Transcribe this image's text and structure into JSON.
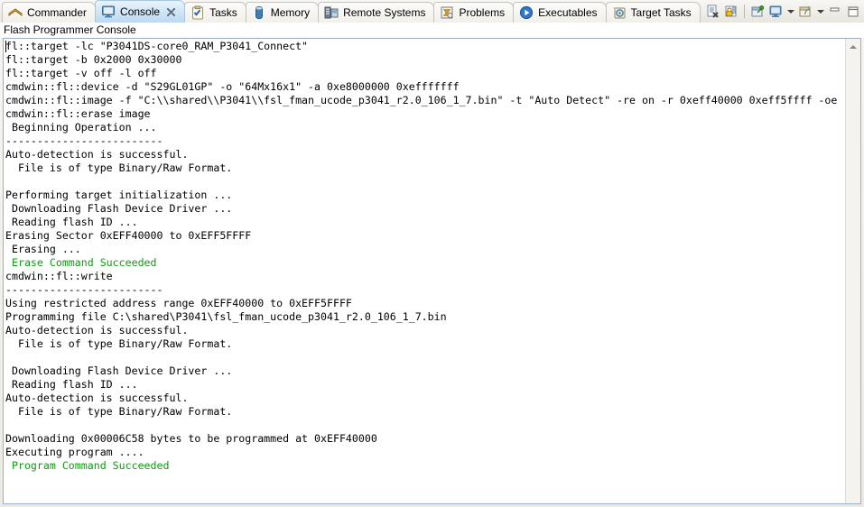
{
  "window": {
    "view_title": "Flash Programmer Console"
  },
  "tabs": [
    {
      "label": "Commander",
      "icon": "commander-icon",
      "active": false,
      "closable": false
    },
    {
      "label": "Console",
      "icon": "console-icon",
      "active": true,
      "closable": true
    },
    {
      "label": "Tasks",
      "icon": "tasks-icon",
      "active": false,
      "closable": false
    },
    {
      "label": "Memory",
      "icon": "memory-icon",
      "active": false,
      "closable": false
    },
    {
      "label": "Remote Systems",
      "icon": "remote-systems-icon",
      "active": false,
      "closable": false
    },
    {
      "label": "Problems",
      "icon": "problems-icon",
      "active": false,
      "closable": false
    },
    {
      "label": "Executables",
      "icon": "executables-icon",
      "active": false,
      "closable": false
    },
    {
      "label": "Target Tasks",
      "icon": "target-tasks-icon",
      "active": false,
      "closable": false
    }
  ],
  "toolbar": {
    "buttons": [
      {
        "name": "clear-console-icon",
        "title": "Clear Console"
      },
      {
        "name": "scroll-lock-icon",
        "title": "Scroll Lock"
      },
      {
        "name": "pin-console-icon",
        "title": "Pin Console"
      },
      {
        "name": "display-console-icon",
        "title": "Display Selected Console"
      },
      {
        "name": "open-console-icon",
        "title": "Open Console"
      },
      {
        "name": "minimize-icon",
        "title": "Minimize"
      },
      {
        "name": "maximize-icon",
        "title": "Maximize"
      }
    ]
  },
  "console": {
    "lines": [
      {
        "text": "fl::target -lc \"P3041DS-core0_RAM_P3041_Connect\"",
        "color": "black"
      },
      {
        "text": "fl::target -b 0x2000 0x30000",
        "color": "black"
      },
      {
        "text": "fl::target -v off -l off",
        "color": "black"
      },
      {
        "text": "cmdwin::fl::device -d \"S29GL01GP\" -o \"64Mx16x1\" -a 0xe8000000 0xefffffff",
        "color": "black"
      },
      {
        "text": "cmdwin::fl::image -f \"C:\\\\shared\\\\P3041\\\\fsl_fman_ucode_p3041_r2.0_106_1_7.bin\" -t \"Auto Detect\" -re on -r 0xeff40000 0xeff5ffff -oe",
        "color": "black"
      },
      {
        "text": "cmdwin::fl::erase image",
        "color": "black"
      },
      {
        "text": " Beginning Operation ...",
        "color": "black"
      },
      {
        "text": "-------------------------",
        "color": "black"
      },
      {
        "text": "Auto-detection is successful.",
        "color": "black"
      },
      {
        "text": "  File is of type Binary/Raw Format.",
        "color": "black"
      },
      {
        "text": "",
        "color": "black"
      },
      {
        "text": "Performing target initialization ...",
        "color": "black"
      },
      {
        "text": " Downloading Flash Device Driver ...",
        "color": "black"
      },
      {
        "text": " Reading flash ID ...",
        "color": "black"
      },
      {
        "text": "Erasing Sector 0xEFF40000 to 0xEFF5FFFF",
        "color": "black"
      },
      {
        "text": " Erasing ...",
        "color": "black"
      },
      {
        "text": " Erase Command Succeeded",
        "color": "green"
      },
      {
        "text": "cmdwin::fl::write",
        "color": "black"
      },
      {
        "text": "-------------------------",
        "color": "black"
      },
      {
        "text": "Using restricted address range 0xEFF40000 to 0xEFF5FFFF",
        "color": "black"
      },
      {
        "text": "Programming file C:\\shared\\P3041\\fsl_fman_ucode_p3041_r2.0_106_1_7.bin",
        "color": "black"
      },
      {
        "text": "Auto-detection is successful.",
        "color": "black"
      },
      {
        "text": "  File is of type Binary/Raw Format.",
        "color": "black"
      },
      {
        "text": "",
        "color": "black"
      },
      {
        "text": " Downloading Flash Device Driver ...",
        "color": "black"
      },
      {
        "text": " Reading flash ID ...",
        "color": "black"
      },
      {
        "text": "Auto-detection is successful.",
        "color": "black"
      },
      {
        "text": "  File is of type Binary/Raw Format.",
        "color": "black"
      },
      {
        "text": "",
        "color": "black"
      },
      {
        "text": "Downloading 0x00006C58 bytes to be programmed at 0xEFF40000",
        "color": "black"
      },
      {
        "text": "Executing program ....",
        "color": "black"
      },
      {
        "text": " Program Command Succeeded",
        "color": "green"
      }
    ]
  },
  "colors": {
    "success_green": "#119911",
    "console_text": "#000000",
    "active_tab": "#cfe4f6"
  }
}
